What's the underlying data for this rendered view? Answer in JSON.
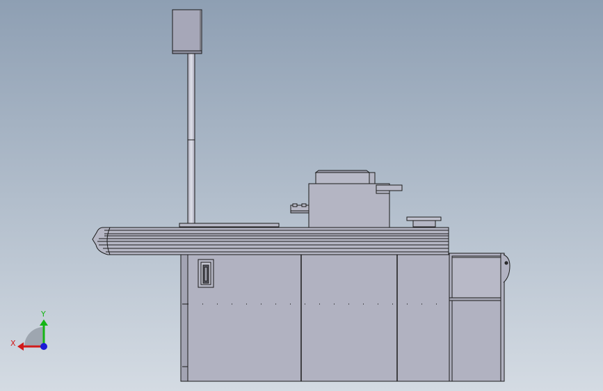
{
  "viewport": {
    "background_top": "#8e9fb3",
    "background_bottom": "#d4dbe3"
  },
  "model": {
    "body_color": "#b2b3c2",
    "body_color_light": "#c1c2cf",
    "edge_color": "#1a1a1a",
    "pole_color": "#c7c8d6",
    "panel_color": "#9a9aab"
  },
  "triad": {
    "x_label": "X",
    "y_label": "Y",
    "x_color": "#d11a1a",
    "y_color": "#15b515",
    "z_color": "#1b1bd6"
  }
}
